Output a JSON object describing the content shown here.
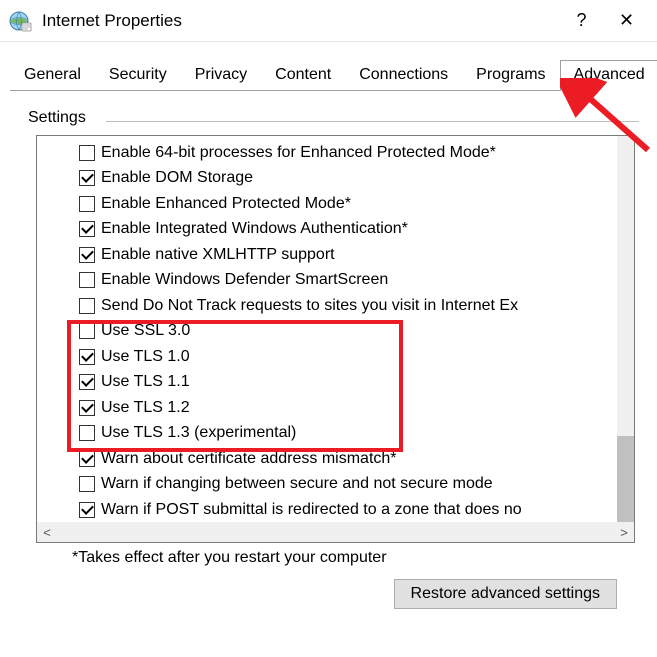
{
  "window": {
    "title": "Internet Properties",
    "help_symbol": "?",
    "close_symbol": "✕"
  },
  "tabs": {
    "items": [
      {
        "label": "General",
        "active": false
      },
      {
        "label": "Security",
        "active": false
      },
      {
        "label": "Privacy",
        "active": false
      },
      {
        "label": "Content",
        "active": false
      },
      {
        "label": "Connections",
        "active": false
      },
      {
        "label": "Programs",
        "active": false
      },
      {
        "label": "Advanced",
        "active": true
      }
    ]
  },
  "settings": {
    "group_label": "Settings",
    "items": [
      {
        "label": "Enable 64-bit processes for Enhanced Protected Mode*",
        "checked": false
      },
      {
        "label": "Enable DOM Storage",
        "checked": true
      },
      {
        "label": "Enable Enhanced Protected Mode*",
        "checked": false
      },
      {
        "label": "Enable Integrated Windows Authentication*",
        "checked": true
      },
      {
        "label": "Enable native XMLHTTP support",
        "checked": true
      },
      {
        "label": "Enable Windows Defender SmartScreen",
        "checked": false
      },
      {
        "label": "Send Do Not Track requests to sites you visit in Internet Ex",
        "checked": false
      },
      {
        "label": "Use SSL 3.0",
        "checked": false
      },
      {
        "label": "Use TLS 1.0",
        "checked": true
      },
      {
        "label": "Use TLS 1.1",
        "checked": true
      },
      {
        "label": "Use TLS 1.2",
        "checked": true
      },
      {
        "label": "Use TLS 1.3 (experimental)",
        "checked": false
      },
      {
        "label": "Warn about certificate address mismatch*",
        "checked": true
      },
      {
        "label": "Warn if changing between secure and not secure mode",
        "checked": false
      },
      {
        "label": "Warn if POST submittal is redirected to a zone that does no",
        "checked": true
      }
    ],
    "footnote": "*Takes effect after you restart your computer",
    "restore_label": "Restore advanced settings",
    "scroll_left": "<",
    "scroll_right": ">"
  },
  "annotation": {
    "highlight_start": 7,
    "highlight_end": 11,
    "arrow_target": "tab-advanced",
    "arrow_color": "#ec1c24"
  }
}
